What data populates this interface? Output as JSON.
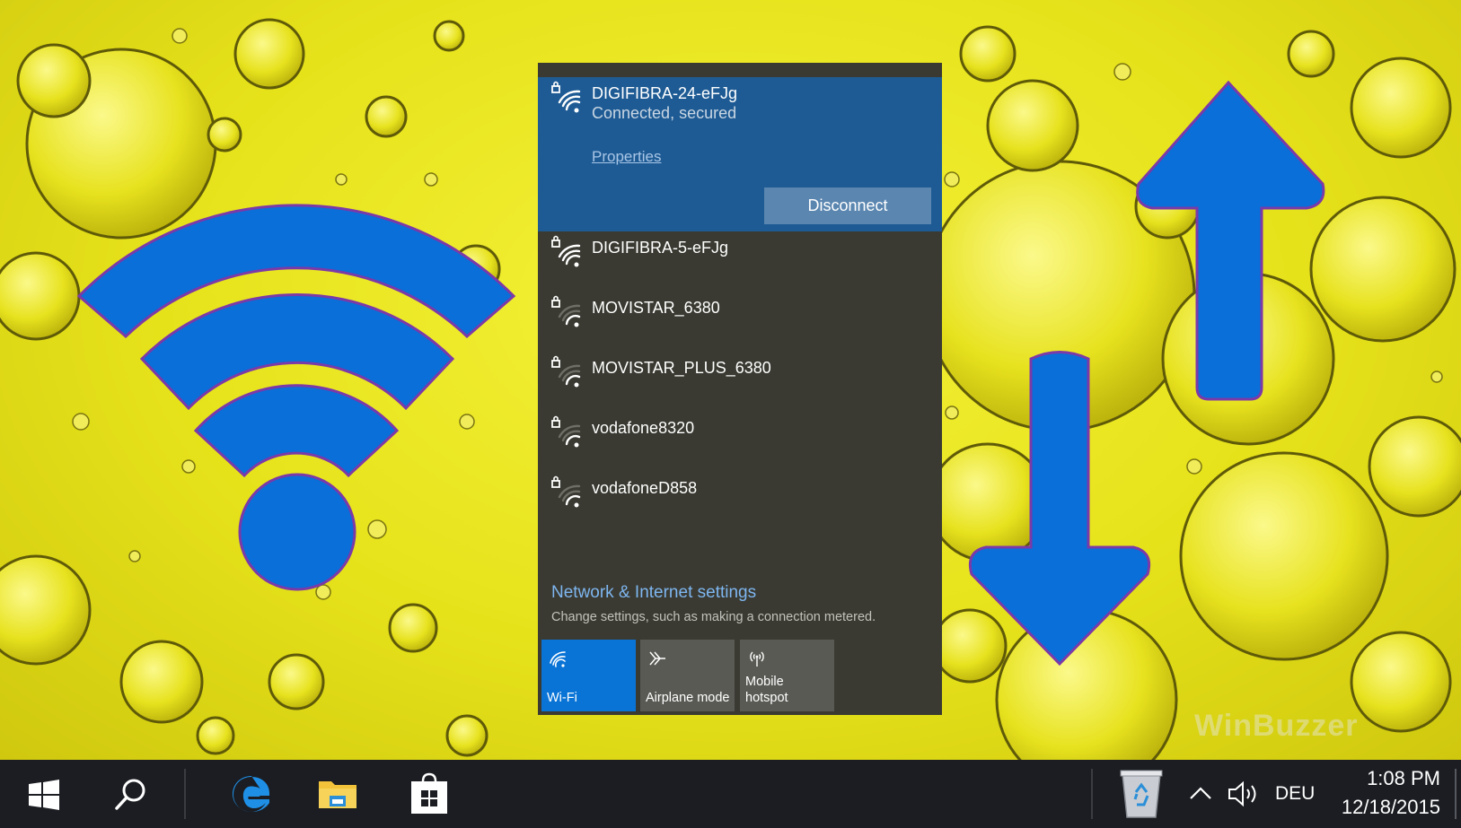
{
  "connected_network": {
    "name": "DIGIFIBRA-24-eFJg",
    "status": "Connected, secured",
    "properties_label": "Properties",
    "disconnect_label": "Disconnect"
  },
  "networks": [
    {
      "name": "DIGIFIBRA-5-eFJg",
      "secured": true,
      "signal": "full"
    },
    {
      "name": "MOVISTAR_6380",
      "secured": true,
      "signal": "low"
    },
    {
      "name": "MOVISTAR_PLUS_6380",
      "secured": true,
      "signal": "low"
    },
    {
      "name": "vodafone8320",
      "secured": true,
      "signal": "low"
    },
    {
      "name": "vodafoneD858",
      "secured": true,
      "signal": "low"
    }
  ],
  "settings": {
    "title": "Network & Internet settings",
    "subtitle": "Change settings, such as making a connection metered."
  },
  "quick_actions": [
    {
      "label": "Wi-Fi",
      "icon": "wifi-icon",
      "active": true
    },
    {
      "label": "Airplane mode",
      "icon": "airplane-icon",
      "active": false
    },
    {
      "label": "Mobile\nhotspot",
      "icon": "hotspot-icon",
      "active": false
    }
  ],
  "taskbar": {
    "pinned": [
      "start-icon",
      "search-icon",
      "edge-icon",
      "file-explorer-icon",
      "store-icon"
    ],
    "tray": {
      "language": "DEU",
      "time": "1:08 PM",
      "date": "12/18/2015"
    }
  },
  "watermark": "WinBuzzer",
  "colors": {
    "connected_bg": "#1e5b94",
    "flyout_bg": "#3a3a32",
    "accent": "#0a74d6",
    "desktop_yellow": "#e6e21a",
    "graphic_blue": "#0a6fd8"
  }
}
